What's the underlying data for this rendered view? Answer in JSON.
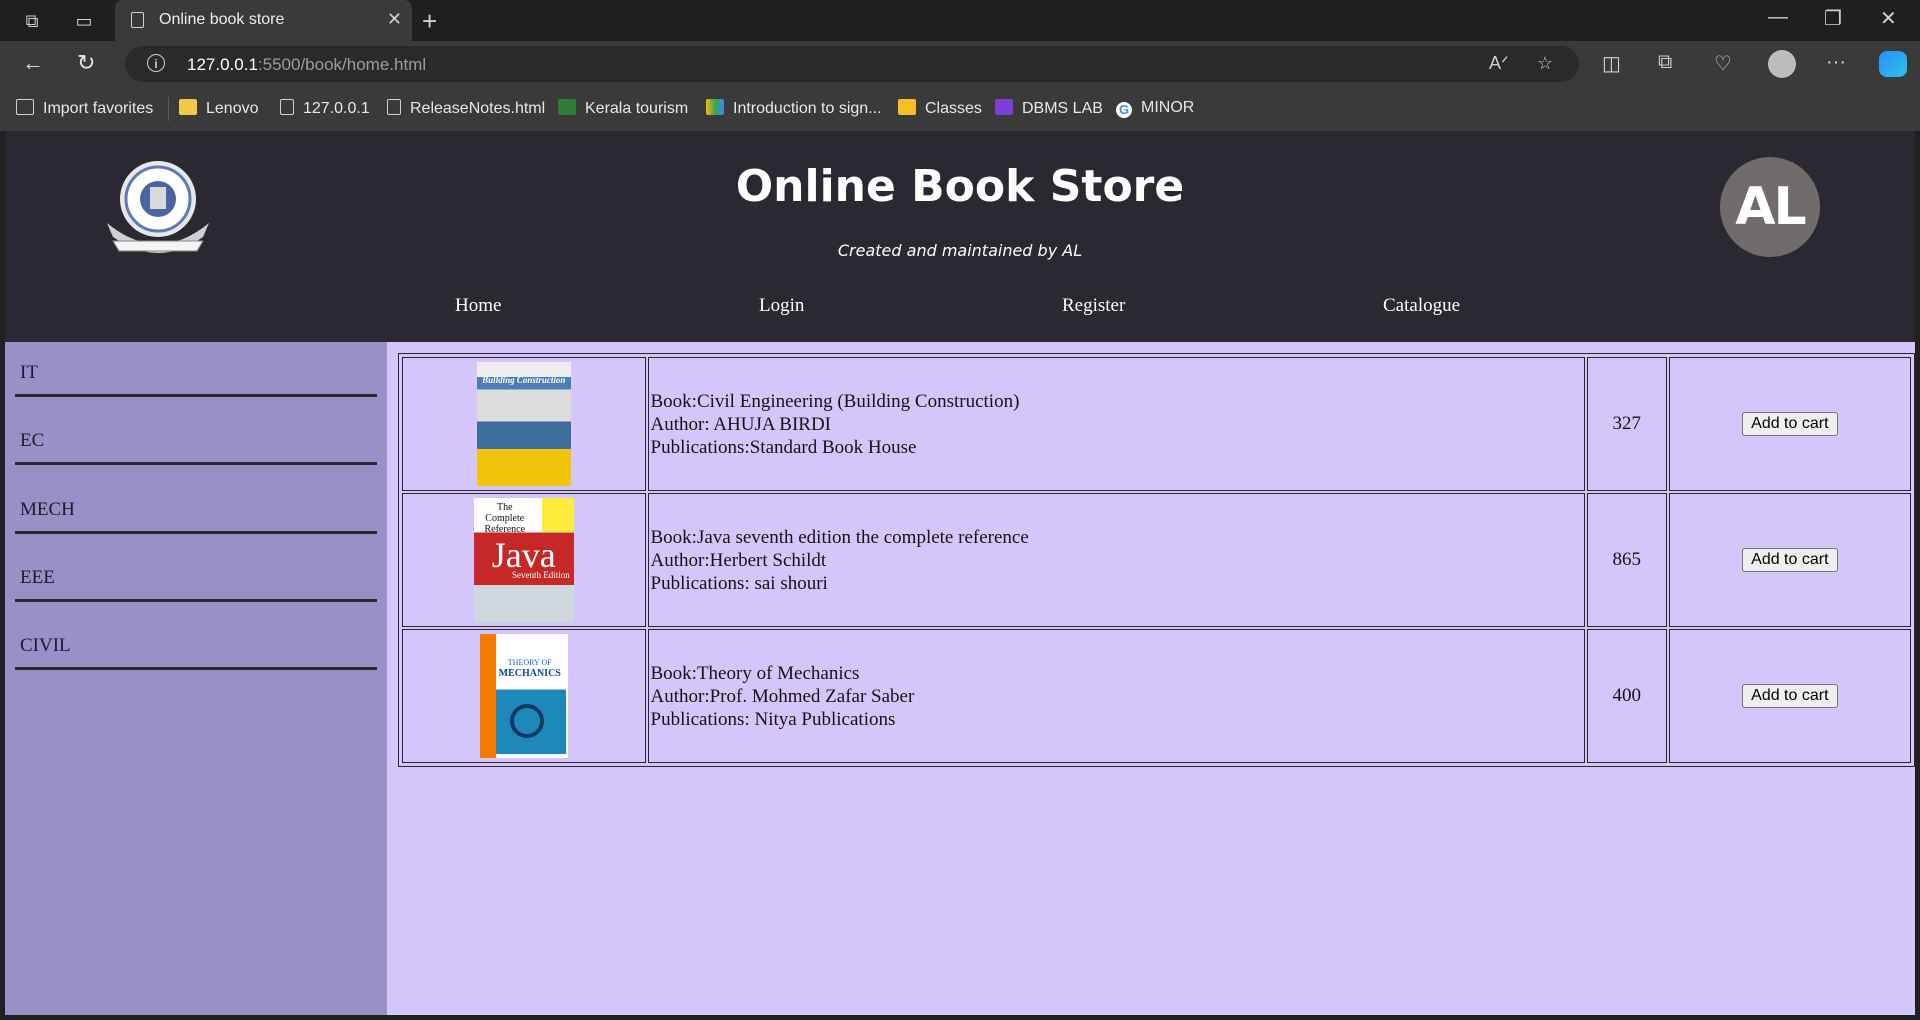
{
  "browser": {
    "tab_title": "Online book store",
    "url_host": "127.0.0.1",
    "url_rest": ":5500/book/home.html",
    "bookmarks": [
      "Import favorites",
      "Lenovo",
      "127.0.0.1",
      "ReleaseNotes.html",
      "Kerala tourism",
      "Introduction to sign...",
      "Classes",
      "DBMS LAB",
      "MINOR"
    ]
  },
  "site": {
    "title": "Online Book Store",
    "subtitle": "Created and maintained by AL",
    "avatar_text": "AL",
    "nav": [
      "Home",
      "Login",
      "Register",
      "Catalogue"
    ],
    "categories": [
      "IT",
      "EC",
      "MECH",
      "EEE",
      "CIVIL"
    ]
  },
  "books": [
    {
      "book": "Book:Civil Engineering (Building Construction)",
      "author": "Author: AHUJA BIRDI",
      "pub": "Publications:Standard Book House",
      "price": "327",
      "action": "Add to cart"
    },
    {
      "book": "Book:Java seventh edition the complete reference",
      "author": "Author:Herbert Schildt",
      "pub": "Publications: sai shouri",
      "price": "865",
      "action": "Add to cart"
    },
    {
      "book": "Book:Theory of Mechanics",
      "author": "Author:Prof. Mohmed Zafar Saber",
      "pub": "Publications: Nitya Publications",
      "price": "400",
      "action": "Add to cart"
    }
  ],
  "covers": [
    {
      "text": "Building Construction"
    },
    {
      "text_top": "The Complete Reference",
      "text_mid": "Java",
      "text_bot": "Seventh Edition"
    },
    {
      "text_top": "THEORY OF",
      "text_mid": "MECHANICS"
    }
  ],
  "colors": {
    "page_bg": "#d4c5fb",
    "header_bg": "#2a2830",
    "sidebar_bg": "#9890c6"
  }
}
